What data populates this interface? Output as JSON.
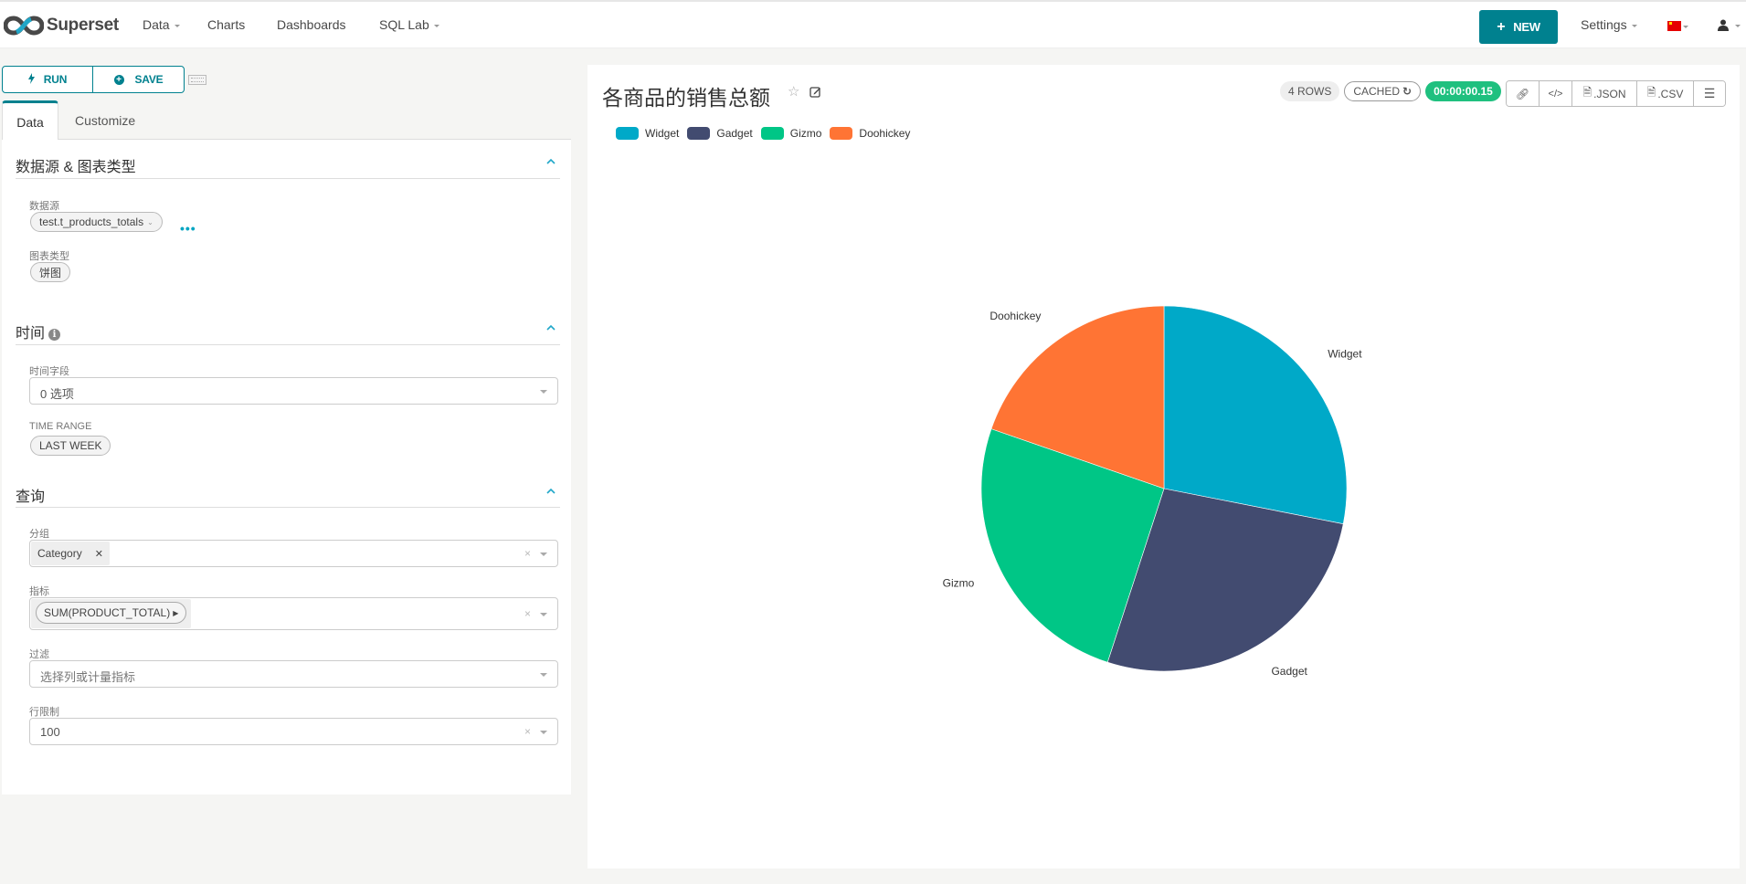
{
  "nav": {
    "brand": "Superset",
    "items": [
      {
        "label": "Data",
        "has_caret": true
      },
      {
        "label": "Charts",
        "has_caret": false
      },
      {
        "label": "Dashboards",
        "has_caret": false
      },
      {
        "label": "SQL Lab",
        "has_caret": true
      }
    ],
    "new_button": "NEW",
    "settings": "Settings",
    "language_icon": "china-flag-icon",
    "user_icon": "user-icon"
  },
  "toolbar": {
    "run_label": "RUN",
    "save_label": "SAVE",
    "run_icon": "bolt-icon",
    "save_icon": "plus-circle-icon",
    "keyboard_icon": "keyboard-icon"
  },
  "tabs": [
    {
      "label": "Data",
      "active": true
    },
    {
      "label": "Customize",
      "active": false
    }
  ],
  "sections": {
    "datasource": {
      "title": "数据源 & 图表类型",
      "datasource_label": "数据源",
      "datasource_value": "test.t_products_totals",
      "viz_type_label": "图表类型",
      "viz_type_value": "饼图"
    },
    "time": {
      "title": "时间",
      "time_column_label": "时间字段",
      "time_column_value": "0 选项",
      "time_range_label": "TIME RANGE",
      "time_range_value": "LAST WEEK"
    },
    "query": {
      "title": "查询",
      "groupby_label": "分组",
      "groupby_values": [
        "Category"
      ],
      "metrics_label": "指标",
      "metrics_values": [
        "SUM(PRODUCT_TOTAL)"
      ],
      "filters_label": "过滤",
      "filters_placeholder": "选择列或计量指标",
      "row_limit_label": "行限制",
      "row_limit_value": "100"
    }
  },
  "chart": {
    "title": "各商品的销售总额",
    "rows_badge": "4 ROWS",
    "cached_badge": "CACHED",
    "timer": "00:00:00.15",
    "actions": [
      {
        "name": "link",
        "label": "",
        "icon": "link-icon"
      },
      {
        "name": "embed",
        "label": "",
        "icon": "code-icon"
      },
      {
        "name": "json",
        "label": ".JSON",
        "icon": "file-json-icon"
      },
      {
        "name": "csv",
        "label": ".CSV",
        "icon": "file-csv-icon"
      },
      {
        "name": "menu",
        "label": "",
        "icon": "hamburger-icon"
      }
    ]
  },
  "colors": {
    "brand": "#00818f",
    "timer_green": "#1fc07f",
    "widget": "#00a9c8",
    "gadget": "#424b70",
    "gizmo": "#00c686",
    "doohickey": "#ff7434"
  },
  "chart_data": {
    "type": "pie",
    "title": "各商品的销售总额",
    "metric": "SUM(PRODUCT_TOTAL)",
    "groupby": "Category",
    "legend_position": "top-left",
    "categories": [
      "Widget",
      "Gadget",
      "Gizmo",
      "Doohickey"
    ],
    "values_percent": [
      28.1,
      26.9,
      25.3,
      19.7
    ],
    "series_colors": [
      "#00a9c8",
      "#424b70",
      "#00c686",
      "#ff7434"
    ]
  }
}
